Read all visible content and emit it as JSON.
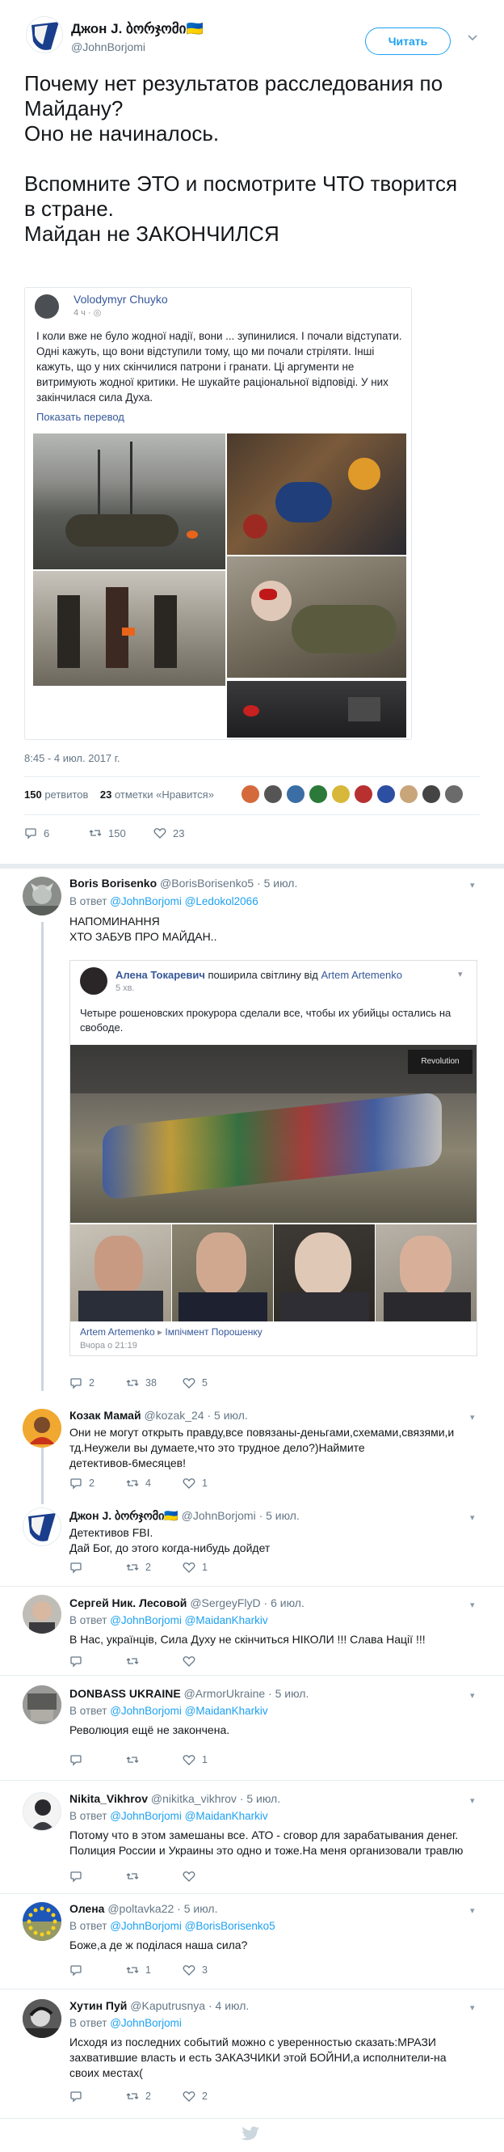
{
  "tweet": {
    "name": "Джон J. ბორჯომი🇺🇦",
    "handle": "@JohnBorjomi",
    "follow_label": "Читать",
    "text": "Почему нет результатов расследования по Майдану?\nОно не начиналось.\n\nВспомните ЭТО и посмотрите ЧТО творится\nв стране.\nМайдан не ЗАКОНЧИЛСЯ",
    "card": {
      "author": "Volodymyr Chuyko",
      "time": "4 ч · ",
      "text": "І коли вже не було жодної надії, вони ... зупинилися. І почали відступати. Одні кажуть, що вони відступили тому, що ми почали стріляти. Інші кажуть, що у них скінчилися патрони і гранати. Ці аргументи не витримують жодної критики. Не шукайте раціональної відповіді. У них закінчилася сила Духа.",
      "show_translation": "Показать перевод"
    },
    "date": "8:45 - 4 июл. 2017 г.",
    "retweets_count": "150",
    "retweets_label": " ретвитов",
    "likes_count": "23",
    "likes_label": " отметки «Нравится»",
    "actions": {
      "replies": "6",
      "retweets": "150",
      "likes": "23"
    }
  },
  "replies": [
    {
      "name": "Boris Borisenko",
      "handle": "@BorisBorisenko5 · 5 июл.",
      "reply_to_label": "В ответ",
      "reply_to": "@JohnBorjomi @Ledokol2066",
      "text": "НАПОМИНАННЯ\nХТО ЗАБУВ ПРО МАЙДАН..",
      "embed": {
        "author": "Алена Токаревич",
        "shared": " поширила світлину від ",
        "shared_author": "Artem Artemenko",
        "time": "5 хв.",
        "text": "Четыре рошеновских прокурора сделали все, чтобы их убийцы остались на свободе.",
        "footer_author": "Artem Artemenko",
        "footer_arrow": " ▸ ",
        "footer_group": "Імпічмент Порошенку",
        "footer_time": "Вчора о 21:19",
        "photo_label": "Revolution"
      },
      "actions": {
        "replies": "2",
        "retweets": "38",
        "likes": "5"
      }
    },
    {
      "name": "Козак Мамай",
      "handle": "@kozak_24 · 5 июл.",
      "text": "Они не могут открыть правду,все повязаны-деньгами,схемами,связями,и тд.Неужели вы думаете,что это трудное дело?)Наймите детективов-6месяцев!",
      "actions": {
        "replies": "2",
        "retweets": "4",
        "likes": "1"
      }
    },
    {
      "name": "Джон J. ბორჯომი🇺🇦",
      "handle": "@JohnBorjomi · 5 июл.",
      "text": "Детективов FBI.\nДай Бог, до этого когда-нибудь дойдет",
      "actions": {
        "replies": "",
        "retweets": "2",
        "likes": "1"
      }
    },
    {
      "name": "Сергей Ник. Лесовой",
      "handle": "@SergeyFlyD · 6 июл.",
      "reply_to_label": "В ответ",
      "reply_to": "@JohnBorjomi @MaidanKharkiv",
      "text": "В Нас, українців, Сила Духу не скінчиться НІКОЛИ !!! Слава Нації !!!",
      "actions": {
        "replies": "",
        "retweets": "",
        "likes": ""
      }
    },
    {
      "name": "DONBASS UKRAINE",
      "handle": "@ArmorUkraine · 5 июл.",
      "reply_to_label": "В ответ",
      "reply_to": "@JohnBorjomi @MaidanKharkiv",
      "text": "Революция  ещё  не  закончена.",
      "actions": {
        "replies": "",
        "retweets": "",
        "likes": "1"
      }
    },
    {
      "name": "Nikita_Vikhrov",
      "handle": "@nikitka_vikhrov · 5 июл.",
      "reply_to_label": "В ответ",
      "reply_to": "@JohnBorjomi @MaidanKharkiv",
      "text": "Потому что в этом замешаны все. АТО - сговор для зарабатывания денег. Полиция России и Украины это одно и тоже.На меня организовали травлю",
      "actions": {
        "replies": "",
        "retweets": "",
        "likes": ""
      }
    },
    {
      "name": "Олена",
      "handle": "@poltavka22 · 5 июл.",
      "reply_to_label": "В ответ",
      "reply_to": "@JohnBorjomi @BorisBorisenko5",
      "text": "Боже,а де ж поділася наша сила?",
      "actions": {
        "replies": "",
        "retweets": "1",
        "likes": "3"
      }
    },
    {
      "name": "Хутин Пуй",
      "handle": "@Kaputrusnya · 4 июл.",
      "reply_to_label": "В ответ",
      "reply_to": "@JohnBorjomi",
      "text": "Исходя из последних событий можно с уверенностью сказать:МРАЗИ захватившие власть и есть ЗАКАЗЧИКИ этой БОЙНИ,а исполнители-на своих местах(",
      "actions": {
        "replies": "",
        "retweets": "2",
        "likes": "2"
      }
    }
  ],
  "colors": {
    "accent": "#1da1f2",
    "text": "#14171a",
    "muted": "#657786",
    "border": "#e6ecf0"
  }
}
